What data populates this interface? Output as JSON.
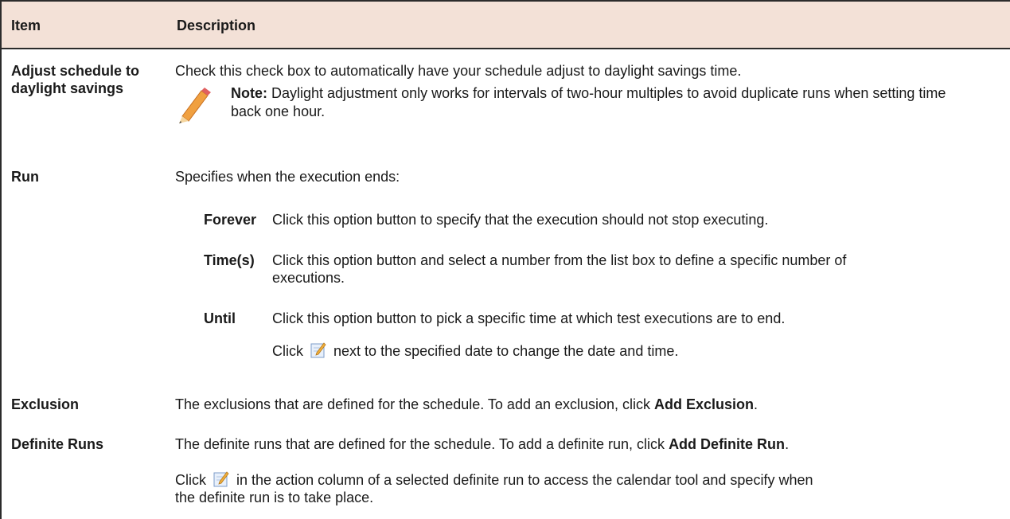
{
  "header": {
    "item": "Item",
    "description": "Description"
  },
  "rows": {
    "adjust": {
      "item": "Adjust schedule to daylight savings",
      "desc": "Check this check box to automatically have your schedule adjust to daylight savings time.",
      "note_label": "Note:",
      "note_text": " Daylight adjustment only works for intervals of two-hour multiples to avoid duplicate runs when setting time back one hour."
    },
    "run": {
      "item": "Run",
      "desc": "Specifies when the execution ends:",
      "options": [
        {
          "term": "Forever",
          "desc": "Click this option button to specify that the execution should not stop executing."
        },
        {
          "term": "Time(s)",
          "desc": "Click this option button and select a number from the list box to define a specific number of executions."
        },
        {
          "term": "Until",
          "desc": "Click this option button to pick a specific time at which test executions are to end."
        }
      ],
      "until_click": "Click",
      "until_rest": "next to the specified date to change the date and time."
    },
    "exclusion": {
      "item": "Exclusion",
      "desc": "The exclusions that are defined for the schedule. To add an exclusion, click ",
      "bold": "Add Exclusion",
      "end": "."
    },
    "definite": {
      "item": "Definite Runs",
      "desc": "The definite runs that are defined for the schedule. To add a definite run, click ",
      "bold": "Add Definite Run",
      "end": ".",
      "click": "Click",
      "rest": "in the action column of a selected definite run to access the calendar tool and specify when the definite run is to take place."
    }
  },
  "icons": {
    "note": "pencil-icon",
    "edit": "edit-icon"
  },
  "colors": {
    "header_bg": "#f3e1d7",
    "border": "#2b2b2b"
  }
}
